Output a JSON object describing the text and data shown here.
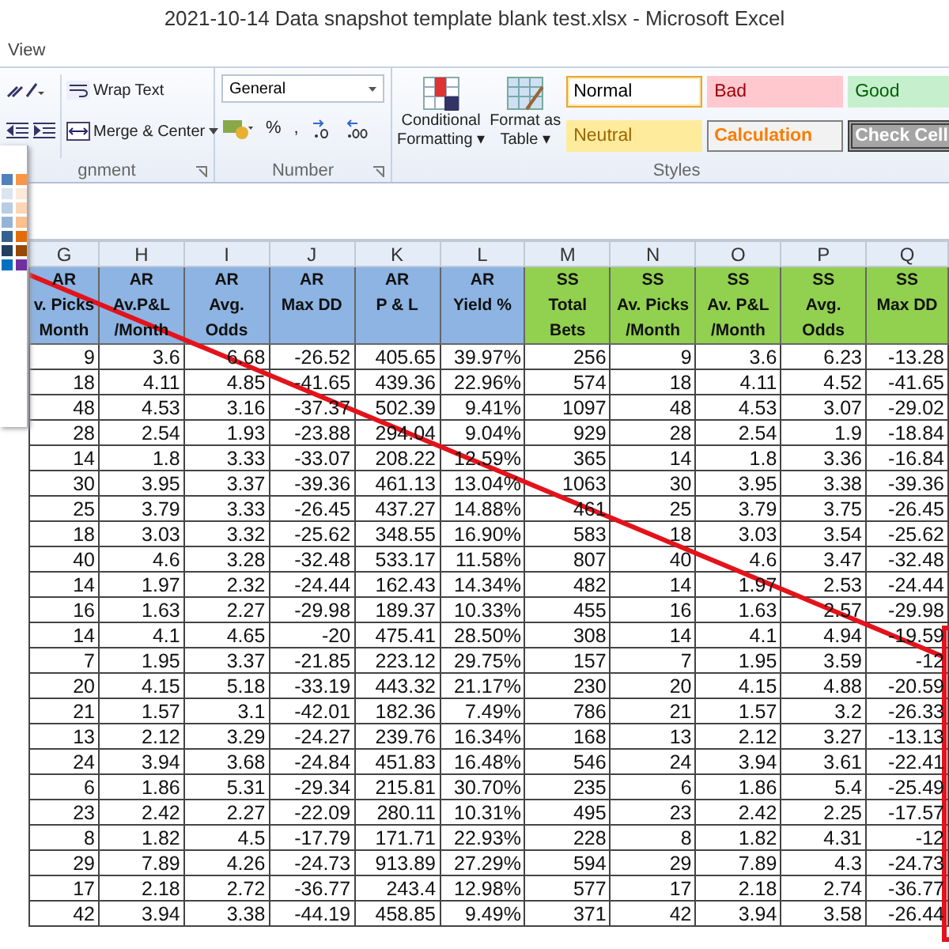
{
  "window": {
    "title": "2021-10-14 Data snapshot template blank test.xlsx  -  Microsoft Excel"
  },
  "menu": [
    {
      "label": "View",
      "selected": false
    }
  ],
  "ribbon": {
    "alignment": {
      "wrap_text": "Wrap Text",
      "merge_center": "Merge & Center",
      "label": "gnment"
    },
    "number": {
      "format": "General",
      "percent": "%",
      "comma": ",",
      "label": "Number"
    },
    "styles": {
      "commands": [
        "Conditional\nFormatting ▾",
        "Format as\nTable ▾"
      ],
      "cell_styles": [
        {
          "label": "Normal",
          "kind": "normal",
          "selected": true
        },
        {
          "label": "Bad",
          "kind": "bad",
          "selected": false
        },
        {
          "label": "Good",
          "kind": "good",
          "selected": false
        },
        {
          "label": "Neutral",
          "kind": "neutral",
          "selected": false
        },
        {
          "label": "Calculation",
          "kind": "calculation",
          "selected": false
        },
        {
          "label": "Check Cell",
          "kind": "check",
          "selected": false
        }
      ],
      "label": "Styles"
    }
  },
  "palette": {
    "swatches": [
      {
        "color": "#4f81bd"
      },
      {
        "color": "#f79646"
      },
      {
        "color": "#dbe5f1"
      },
      {
        "color": "#fde9d9"
      },
      {
        "color": "#b8cce4"
      },
      {
        "color": "#fbd5b5"
      },
      {
        "color": "#95b3d7"
      },
      {
        "color": "#fac08f"
      },
      {
        "color": "#366092"
      },
      {
        "color": "#e36c09"
      },
      {
        "color": "#244061"
      },
      {
        "color": "#984806"
      },
      {
        "color": "#0070c0"
      },
      {
        "color": "#7030a0"
      }
    ]
  },
  "sheet": {
    "columns": [
      {
        "letter": "G",
        "color": "#8db4e2",
        "title": [
          "AR",
          "v. Picks",
          "Month"
        ]
      },
      {
        "letter": "H",
        "color": "#8db4e2",
        "title": [
          "AR",
          "Av.P&L",
          "/Month"
        ]
      },
      {
        "letter": "I",
        "color": "#8db4e2",
        "title": [
          "AR",
          "Avg.",
          "Odds"
        ]
      },
      {
        "letter": "J",
        "color": "#8db4e2",
        "title": [
          "AR",
          "Max DD"
        ]
      },
      {
        "letter": "K",
        "color": "#8db4e2",
        "title": [
          "AR",
          "P & L"
        ]
      },
      {
        "letter": "L",
        "color": "#8db4e2",
        "title": [
          "AR",
          "Yield %"
        ]
      },
      {
        "letter": "M",
        "color": "#92d050",
        "title": [
          "SS",
          "Total",
          "Bets"
        ]
      },
      {
        "letter": "N",
        "color": "#92d050",
        "title": [
          "SS",
          "Av. Picks",
          "/Month"
        ]
      },
      {
        "letter": "O",
        "color": "#92d050",
        "title": [
          "SS",
          "Av. P&L",
          "/Month"
        ]
      },
      {
        "letter": "P",
        "color": "#92d050",
        "title": [
          "SS",
          "Avg.",
          "Odds"
        ]
      },
      {
        "letter": "Q",
        "color": "#92d050",
        "title": [
          "SS",
          "Max DD"
        ]
      }
    ],
    "rows": [
      [
        "9",
        "3.6",
        "6.68",
        "-26.52",
        "405.65",
        "39.97%",
        "256",
        "9",
        "3.6",
        "6.23",
        "-13.28"
      ],
      [
        "18",
        "4.11",
        "4.85",
        "-41.65",
        "439.36",
        "22.96%",
        "574",
        "18",
        "4.11",
        "4.52",
        "-41.65"
      ],
      [
        "48",
        "4.53",
        "3.16",
        "-37.37",
        "502.39",
        "9.41%",
        "1097",
        "48",
        "4.53",
        "3.07",
        "-29.02"
      ],
      [
        "28",
        "2.54",
        "1.93",
        "-23.88",
        "294.04",
        "9.04%",
        "929",
        "28",
        "2.54",
        "1.9",
        "-18.84"
      ],
      [
        "14",
        "1.8",
        "3.33",
        "-33.07",
        "208.22",
        "12.59%",
        "365",
        "14",
        "1.8",
        "3.36",
        "-16.84"
      ],
      [
        "30",
        "3.95",
        "3.37",
        "-39.36",
        "461.13",
        "13.04%",
        "1063",
        "30",
        "3.95",
        "3.38",
        "-39.36"
      ],
      [
        "25",
        "3.79",
        "3.33",
        "-26.45",
        "437.27",
        "14.88%",
        "461",
        "25",
        "3.79",
        "3.75",
        "-26.45"
      ],
      [
        "18",
        "3.03",
        "3.32",
        "-25.62",
        "348.55",
        "16.90%",
        "583",
        "18",
        "3.03",
        "3.54",
        "-25.62"
      ],
      [
        "40",
        "4.6",
        "3.28",
        "-32.48",
        "533.17",
        "11.58%",
        "807",
        "40",
        "4.6",
        "3.47",
        "-32.48"
      ],
      [
        "14",
        "1.97",
        "2.32",
        "-24.44",
        "162.43",
        "14.34%",
        "482",
        "14",
        "1.97",
        "2.53",
        "-24.44"
      ],
      [
        "16",
        "1.63",
        "2.27",
        "-29.98",
        "189.37",
        "10.33%",
        "455",
        "16",
        "1.63",
        "2.57",
        "-29.98"
      ],
      [
        "14",
        "4.1",
        "4.65",
        "-20",
        "475.41",
        "28.50%",
        "308",
        "14",
        "4.1",
        "4.94",
        "-19.59"
      ],
      [
        "7",
        "1.95",
        "3.37",
        "-21.85",
        "223.12",
        "29.75%",
        "157",
        "7",
        "1.95",
        "3.59",
        "-12"
      ],
      [
        "20",
        "4.15",
        "5.18",
        "-33.19",
        "443.32",
        "21.17%",
        "230",
        "20",
        "4.15",
        "4.88",
        "-20.59"
      ],
      [
        "21",
        "1.57",
        "3.1",
        "-42.01",
        "182.36",
        "7.49%",
        "786",
        "21",
        "1.57",
        "3.2",
        "-26.33"
      ],
      [
        "13",
        "2.12",
        "3.29",
        "-24.27",
        "239.76",
        "16.34%",
        "168",
        "13",
        "2.12",
        "3.27",
        "-13.13"
      ],
      [
        "24",
        "3.94",
        "3.68",
        "-24.84",
        "451.83",
        "16.48%",
        "546",
        "24",
        "3.94",
        "3.61",
        "-22.41"
      ],
      [
        "6",
        "1.86",
        "5.31",
        "-29.34",
        "215.81",
        "30.70%",
        "235",
        "6",
        "1.86",
        "5.4",
        "-25.49"
      ],
      [
        "23",
        "2.42",
        "2.27",
        "-22.09",
        "280.11",
        "10.31%",
        "495",
        "23",
        "2.42",
        "2.25",
        "-17.57"
      ],
      [
        "8",
        "1.82",
        "4.5",
        "-17.79",
        "171.71",
        "22.93%",
        "228",
        "8",
        "1.82",
        "4.31",
        "-12"
      ],
      [
        "29",
        "7.89",
        "4.26",
        "-24.73",
        "913.89",
        "27.29%",
        "594",
        "29",
        "7.89",
        "4.3",
        "-24.73"
      ],
      [
        "17",
        "2.18",
        "2.72",
        "-36.77",
        "243.4",
        "12.98%",
        "577",
        "17",
        "2.18",
        "2.74",
        "-36.77"
      ],
      [
        "42",
        "3.94",
        "3.38",
        "-44.19",
        "458.85",
        "9.49%",
        "371",
        "42",
        "3.94",
        "3.58",
        "-26.44"
      ]
    ]
  }
}
